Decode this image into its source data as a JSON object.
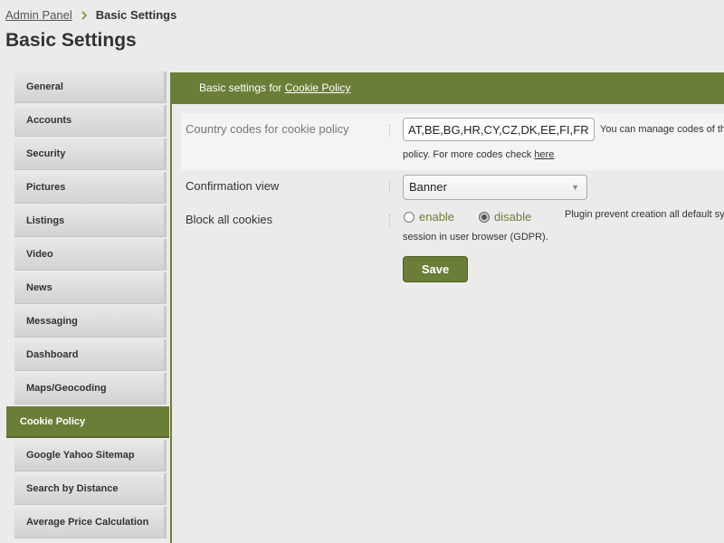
{
  "breadcrumb": {
    "root": "Admin Panel",
    "current": "Basic Settings"
  },
  "page_title": "Basic Settings",
  "sidebar": {
    "items": [
      {
        "label": "General"
      },
      {
        "label": "Accounts"
      },
      {
        "label": "Security"
      },
      {
        "label": "Pictures"
      },
      {
        "label": "Listings"
      },
      {
        "label": "Video"
      },
      {
        "label": "News"
      },
      {
        "label": "Messaging"
      },
      {
        "label": "Dashboard"
      },
      {
        "label": "Maps/Geocoding"
      },
      {
        "label": "Cookie Policy",
        "active": true
      },
      {
        "label": "Google Yahoo Sitemap"
      },
      {
        "label": "Search by Distance"
      },
      {
        "label": "Average Price Calculation"
      }
    ]
  },
  "panel": {
    "header_prefix": "Basic settings for",
    "header_link": "Cookie Policy"
  },
  "form": {
    "country_codes": {
      "label": "Country codes for cookie policy",
      "value": "AT,BE,BG,HR,CY,CZ,DK,EE,FI,FR",
      "hint_line1": "You can manage codes of th",
      "hint_line2_prefix": "policy. For more codes check",
      "hint_link": "here"
    },
    "confirmation_view": {
      "label": "Confirmation view",
      "selected": "Banner"
    },
    "block_cookies": {
      "label": "Block all cookies",
      "option_enable": "enable",
      "option_disable": "disable",
      "selected": "disable",
      "hint_line1": "Plugin prevent creation all default sy",
      "hint_line2": "session in user browser (GDPR)."
    },
    "save_label": "Save"
  },
  "colors": {
    "accent": "#6b7e38",
    "panel_background": "#ebebeb"
  },
  "icons": {
    "breadcrumb_separator": "chevron-right-icon",
    "select_arrow": "caret-down-icon"
  }
}
